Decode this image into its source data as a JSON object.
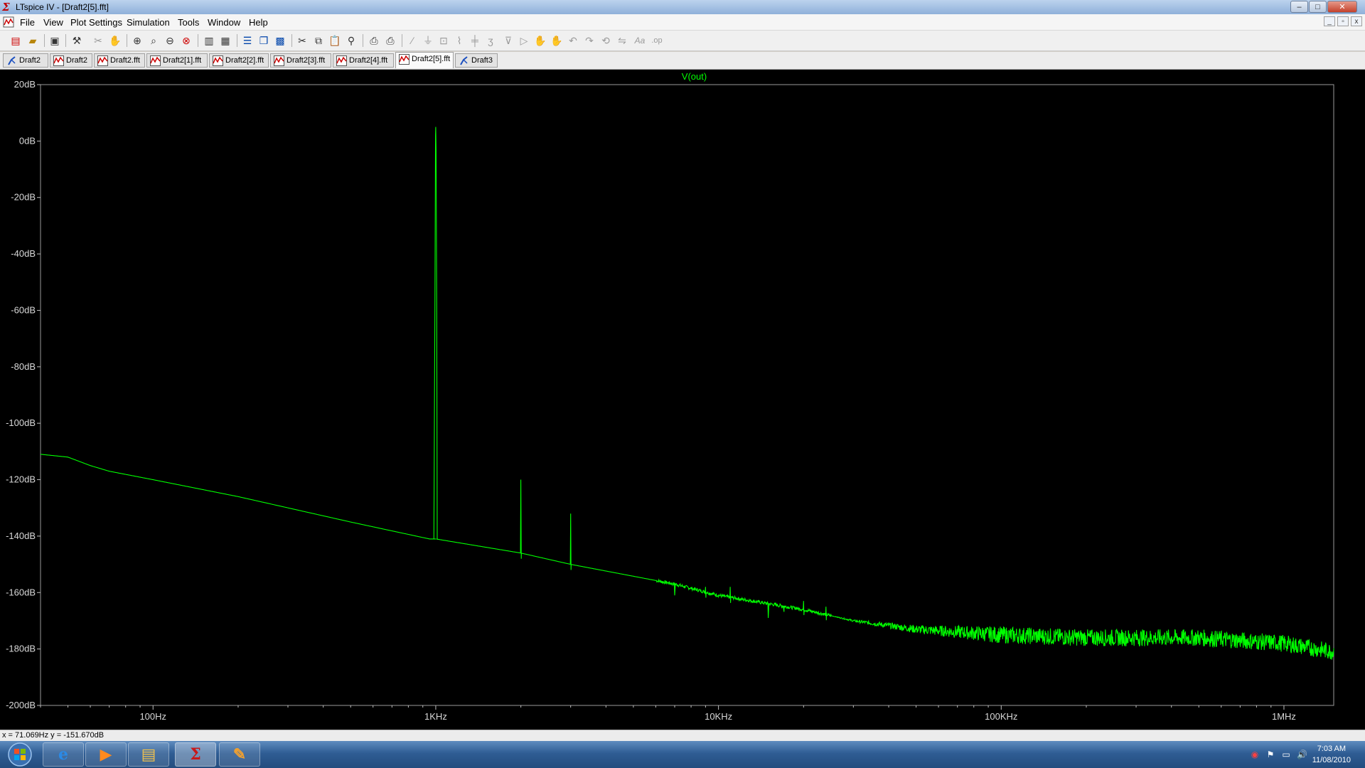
{
  "window": {
    "title": "LTspice IV - [Draft2[5].fft]",
    "controls": {
      "minimize": "–",
      "maximize": "□",
      "close": "✕"
    }
  },
  "menu": {
    "items": [
      "File",
      "View",
      "Plot Settings",
      "Simulation",
      "Tools",
      "Window",
      "Help"
    ],
    "mdi_controls": [
      "_",
      "▫",
      "x"
    ]
  },
  "toolbar": {
    "icons": [
      "new-schematic-icon",
      "open-icon",
      "save-icon",
      "control-panel-icon",
      "cut-wire-icon",
      "pan-hand-icon",
      "zoom-in-icon",
      "zoom-area-icon",
      "zoom-out-icon",
      "zoom-fit-icon",
      "autorange-icon",
      "mark-icon",
      "tile-horizontal-icon",
      "cascade-icon",
      "tile-icon",
      "scissors-icon",
      "copy-icon",
      "paste-icon",
      "find-icon",
      "print-preview-icon",
      "print-icon",
      "wire-icon",
      "ground-icon",
      "label-icon",
      "resistor-icon",
      "capacitor-icon",
      "inductor-icon",
      "diode-icon",
      "component-icon",
      "move-icon",
      "drag-icon",
      "undo-icon",
      "redo-icon",
      "rotate-icon",
      "mirror-icon",
      "text-icon",
      "spice-directive-icon"
    ]
  },
  "tabs": [
    {
      "label": "Draft2",
      "kind": "schematic"
    },
    {
      "label": "Draft2",
      "kind": "waveform"
    },
    {
      "label": "Draft2.fft",
      "kind": "waveform"
    },
    {
      "label": "Draft2[1].fft",
      "kind": "waveform"
    },
    {
      "label": "Draft2[2].fft",
      "kind": "waveform"
    },
    {
      "label": "Draft2[3].fft",
      "kind": "waveform"
    },
    {
      "label": "Draft2[4].fft",
      "kind": "waveform"
    },
    {
      "label": "Draft2[5].fft",
      "kind": "waveform",
      "active": true
    },
    {
      "label": "Draft3",
      "kind": "schematic"
    }
  ],
  "chart_data": {
    "type": "line",
    "title": "V(out)",
    "xscale": "log",
    "xlim": [
      40,
      1500000
    ],
    "ylim": [
      -200,
      20
    ],
    "x_ticks": [
      {
        "value": 100,
        "label": "100Hz"
      },
      {
        "value": 1000,
        "label": "1KHz"
      },
      {
        "value": 10000,
        "label": "10KHz"
      },
      {
        "value": 100000,
        "label": "100KHz"
      },
      {
        "value": 1000000,
        "label": "1MHz"
      }
    ],
    "y_ticks": [
      {
        "value": 20,
        "label": "20dB"
      },
      {
        "value": 0,
        "label": "0dB"
      },
      {
        "value": -20,
        "label": "-20dB"
      },
      {
        "value": -40,
        "label": "-40dB"
      },
      {
        "value": -60,
        "label": "-60dB"
      },
      {
        "value": -80,
        "label": "-80dB"
      },
      {
        "value": -100,
        "label": "-100dB"
      },
      {
        "value": -120,
        "label": "-120dB"
      },
      {
        "value": -140,
        "label": "-140dB"
      },
      {
        "value": -160,
        "label": "-160dB"
      },
      {
        "value": -180,
        "label": "-180dB"
      },
      {
        "value": -200,
        "label": "-200dB"
      }
    ],
    "background": "#000000",
    "trace_color": "#00ff00",
    "series": [
      {
        "name": "V(out)",
        "noise_floor": [
          [
            40,
            -111
          ],
          [
            50,
            -112
          ],
          [
            60,
            -115
          ],
          [
            70,
            -117
          ],
          [
            100,
            -120
          ],
          [
            200,
            -126
          ],
          [
            500,
            -135
          ],
          [
            950,
            -141
          ],
          [
            1000,
            -141
          ],
          [
            2000,
            -146
          ],
          [
            3000,
            -150
          ],
          [
            7000,
            -157
          ],
          [
            10000,
            -161
          ],
          [
            20000,
            -166
          ],
          [
            30000,
            -170
          ],
          [
            50000,
            -173
          ],
          [
            100000,
            -175
          ],
          [
            200000,
            -176
          ],
          [
            500000,
            -176
          ],
          [
            1000000,
            -178
          ],
          [
            1500000,
            -181
          ]
        ],
        "peaks": [
          {
            "x": 1000,
            "y": 5
          },
          {
            "x": 2000,
            "y": -120
          },
          {
            "x": 3000,
            "y": -132
          },
          {
            "x": 7000,
            "y": -161
          },
          {
            "x": 9000,
            "y": -158
          },
          {
            "x": 11000,
            "y": -158
          },
          {
            "x": 15000,
            "y": -169
          },
          {
            "x": 17000,
            "y": -166
          },
          {
            "x": 20000,
            "y": -163
          },
          {
            "x": 24000,
            "y": -165
          }
        ],
        "noise_band": {
          "from": 25000,
          "to": 1500000,
          "amplitude_db": 3
        }
      }
    ]
  },
  "status": {
    "cursor": "x = 71.069Hz   y = -151.670dB"
  },
  "taskbar": {
    "apps": [
      "internet-explorer-icon",
      "media-player-icon",
      "explorer-folder-icon",
      "ltspice-icon",
      "paint-icon"
    ],
    "active_app": 3,
    "clock": {
      "time": "7:03 AM",
      "date": "11/08/2010"
    }
  }
}
